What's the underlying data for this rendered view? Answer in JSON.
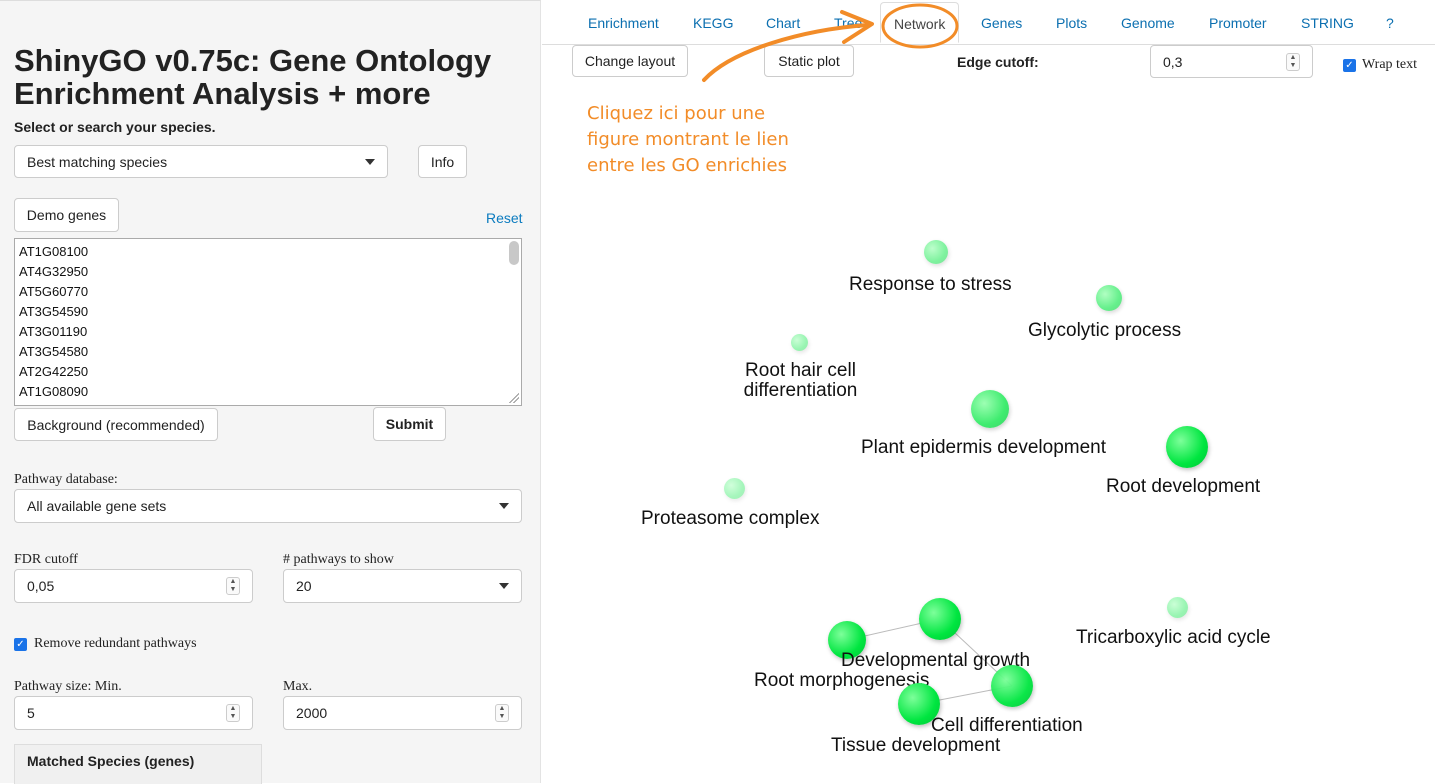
{
  "sidebar": {
    "title": "ShinyGO v0.75c: Gene Ontology Enrichment Analysis + more",
    "species_label": "Select or search your species.",
    "species_value": "Best matching species",
    "info_button": "Info",
    "demo_button": "Demo genes",
    "reset_link": "Reset",
    "genes": [
      "AT1G08100",
      "AT4G32950",
      "AT5G60770",
      "AT3G54590",
      "AT3G01190",
      "AT3G54580",
      "AT2G42250",
      "AT1G08090"
    ],
    "background_button": "Background (recommended)",
    "submit_button": "Submit",
    "pathway_db_label": "Pathway database:",
    "pathway_db_value": "All available gene sets",
    "fdr_label": "FDR cutoff",
    "fdr_value": "0,05",
    "npath_label": "# pathways to show",
    "npath_value": "20",
    "redundant_label": "Remove redundant pathways",
    "size_min_label": "Pathway size: Min.",
    "size_min_value": "5",
    "size_max_label": "Max.",
    "size_max_value": "2000",
    "matched_panel": "Matched Species (genes)"
  },
  "tabs": [
    "Enrichment",
    "KEGG",
    "Chart",
    "Tree",
    "Network",
    "Genes",
    "Plots",
    "Genome",
    "Promoter",
    "STRING",
    "?"
  ],
  "active_tab": "Network",
  "toolbar": {
    "change_layout": "Change layout",
    "static_plot": "Static plot",
    "edge_cutoff_label": "Edge cutoff:",
    "edge_cutoff_value": "0,3",
    "wrap_text": "Wrap text"
  },
  "annotation": {
    "line1": "Cliquez ici pour une",
    "line2": "figure montrant le lien",
    "line3": "entre les GO enrichies",
    "color": "#f28c28"
  },
  "network": {
    "nodes": [
      {
        "label": "Response to stress"
      },
      {
        "label": "Glycolytic process"
      },
      {
        "label": "Root hair cell differentiation"
      },
      {
        "label": "Plant epidermis development"
      },
      {
        "label": "Root development"
      },
      {
        "label": "Proteasome complex"
      },
      {
        "label": "Tricarboxylic acid cycle"
      },
      {
        "label": "Root morphogenesis"
      },
      {
        "label": "Developmental growth"
      },
      {
        "label": "Cell differentiation"
      },
      {
        "label": "Tissue development"
      }
    ],
    "node_color": "#00e640"
  }
}
